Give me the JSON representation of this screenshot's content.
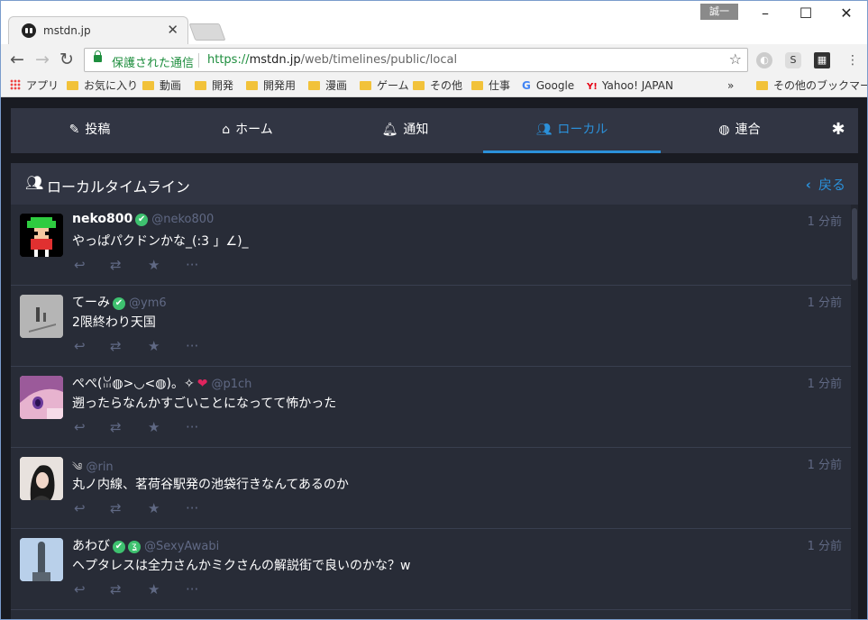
{
  "browser": {
    "tab_title": "mstdn.jp",
    "user_badge": "誠一",
    "secure_label": "保護された通信",
    "url_scheme": "https://",
    "url_host": "mstdn.jp",
    "url_path": "/web/timelines/public/local",
    "bookmarks": [
      {
        "label": "アプリ",
        "type": "apps"
      },
      {
        "label": "お気に入り",
        "type": "folder"
      },
      {
        "label": "動画",
        "type": "folder"
      },
      {
        "label": "開発",
        "type": "folder"
      },
      {
        "label": "開発用",
        "type": "folder"
      },
      {
        "label": "漫画",
        "type": "folder"
      },
      {
        "label": "ゲーム",
        "type": "folder"
      },
      {
        "label": "その他",
        "type": "folder"
      },
      {
        "label": "仕事",
        "type": "folder"
      },
      {
        "label": "Google",
        "type": "link"
      },
      {
        "label": "Yahoo! JAPAN",
        "type": "link"
      }
    ],
    "bookmarks_overflow": "»",
    "other_bookmarks": "その他のブックマーク"
  },
  "nav": {
    "items": [
      {
        "label": "投稿",
        "icon": "pencil-icon"
      },
      {
        "label": "ホーム",
        "icon": "home-icon"
      },
      {
        "label": "通知",
        "icon": "bell-icon"
      },
      {
        "label": "ローカル",
        "icon": "users-icon",
        "active": true
      },
      {
        "label": "連合",
        "icon": "globe-icon"
      }
    ],
    "settings_icon": "asterisk-icon"
  },
  "column": {
    "title": "ローカルタイムライン",
    "back_label": "戻る"
  },
  "statuses": [
    {
      "display_name": "neko800",
      "acct": "@neko800",
      "verified": true,
      "time": "1 分前",
      "content": "やっぱパクドンかな_(:3 」∠)_"
    },
    {
      "display_name": "てーみ",
      "acct": "@ym6",
      "verified": true,
      "time": "1 分前",
      "content": "2限終わり天国"
    },
    {
      "display_name": "ぺぺ(ꈍ◍>◡<◍)。✧",
      "acct": "@p1ch",
      "verified": false,
      "time": "1 分前",
      "content": "遡ったらなんかすごいことになってて怖かった"
    },
    {
      "display_name": "",
      "acct": "@rin",
      "verified": false,
      "time": "1 分前",
      "content": "丸ノ内線、茗荷谷駅発の池袋行きなんてあるのか"
    },
    {
      "display_name": "あわび",
      "acct": "@SexyAwabi",
      "verified": true,
      "time": "1 分前",
      "content": "ヘプタレスは全力さんかミクさんの解説街で良いのかな？w"
    }
  ],
  "colors": {
    "accent": "#2b90d9",
    "background": "#191b22",
    "panel": "#313543",
    "feed": "#282c37",
    "verified": "#3ec16f"
  }
}
